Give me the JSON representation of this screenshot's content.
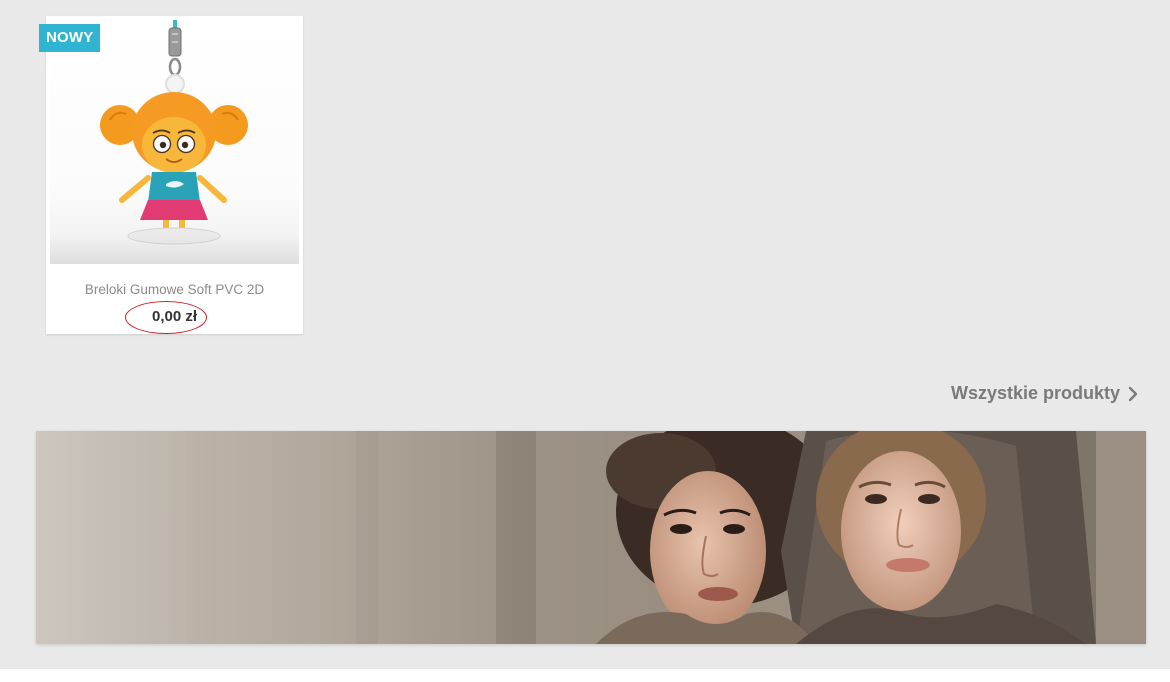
{
  "product": {
    "badge": "NOWY",
    "title": "Breloki Gumowe Soft PVC 2D",
    "price": "0,00 zł"
  },
  "links": {
    "all_products": "Wszystkie produkty"
  },
  "colors": {
    "badge_bg": "#2fb5d2",
    "page_bg": "#e9e9e9",
    "price_circle": "#d02020"
  },
  "icons": {
    "all_products_chevron": "chevron-right-icon"
  }
}
